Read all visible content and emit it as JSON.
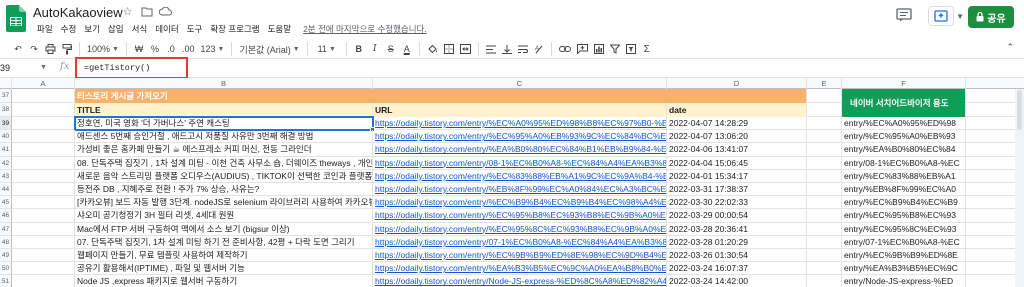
{
  "app": {
    "doc_title": "AutoKakaoview",
    "menu": [
      "파일",
      "수정",
      "보기",
      "삽입",
      "서식",
      "데이터",
      "도구",
      "확장 프로그램",
      "도움말"
    ],
    "last_edit": "2분 전에 마지막으로 수정했습니다.",
    "share_label": "공유"
  },
  "toolbar": {
    "zoom": "100%",
    "currency": "₩",
    "percent": "%",
    "dec_minus": ".0",
    "dec_plus": ".00",
    "number_format": "123",
    "font": "기본값 (Arial)",
    "font_size": "11",
    "bold": "B",
    "italic": "I",
    "strike": "S",
    "text_color": "A"
  },
  "formula": {
    "name_box": "39",
    "formula": "=getTistory()"
  },
  "columns": [
    "A",
    "B",
    "C",
    "D",
    "E",
    "F"
  ],
  "rows": [
    {
      "num": "37",
      "b": "티스토리 게시글 가져오기",
      "c": "",
      "d": "",
      "f": "네이버 서치어드바이저 용도",
      "type": "section"
    },
    {
      "num": "38",
      "b": "TITLE",
      "c": "URL",
      "d": "date",
      "f": "",
      "type": "header"
    },
    {
      "num": "39",
      "b": "정호연, 미국 영화 '더 가버나스' 주연 캐스팅",
      "c": "https://odaily.tistory.com/entry/%EC%A0%95%ED%98%B8%EC%97%B0-%E",
      "d": "2022-04-07 14:28:29",
      "f": "entry/%EC%A0%95%ED%98"
    },
    {
      "num": "40",
      "b": "애드센스 5번째 승인거절 , 애드고시 저품질 사유만 3번째 해결 방법",
      "c": "https://odaily.tistory.com/entry/%EC%95%A0%EB%93%9C%EC%84%BC%E",
      "d": "2022-04-07 13:06:20",
      "f": "entry/%EC%95%A0%EB%93"
    },
    {
      "num": "41",
      "b": "가성비 좋은 홈카페 만들기 ☕ 에스프레소 커피 머신, 전동 그라인더",
      "c": "https://odaily.tistory.com/entry/%EA%B0%80%EC%84%B1%EB%B9%84-%E",
      "d": "2022-04-06 13:41:07",
      "f": "entry/%EA%B0%80%EC%84"
    },
    {
      "num": "42",
      "b": "08. 단독주택 집짓기 , 1차 설계 미팅 - 이천 건축 사무소 숍, 더웨이즈 theways , 개인 건",
      "c": "https://odaily.tistory.com/entry/08-1%EC%B0%A8-%EC%84%A4%EA%B3%8",
      "d": "2022-04-04 15:06:45",
      "f": "entry/08-1%EC%B0%A8-%EC"
    },
    {
      "num": "43",
      "b": "새로운 음악 스트리밍 플랫폼 오디우스(AUDIUS) , TIKTOK이 선택한 코인과 플랫폼",
      "c": "https://odaily.tistory.com/entry/%EC%83%88%EB%A1%9C%EC%9A%B4-%E",
      "d": "2022-04-01 15:34:17",
      "f": "entry/%EC%83%88%EB%A1"
    },
    {
      "num": "44",
      "b": "등전주 DB , 지혜주로 전환 ! 주가 7% 상승, 사유는?",
      "c": "https://odaily.tistory.com/entry/%EB%8F%99%EC%A0%84%EC%A3%BC%E",
      "d": "2022-03-31 17:38:37",
      "f": "entry/%EB%8F%99%EC%A0"
    },
    {
      "num": "45",
      "b": "[카카오뷰] 보드 자동 발행 3단계. nodeJS로 selenium 라이브러리 사용하여 카카오뷰 -",
      "c": "https://odaily.tistory.com/entry/%EC%B9%B4%EC%B9%B4%EC%98%A4%E",
      "d": "2022-03-30 22:02:33",
      "f": "entry/%EC%B9%B4%EC%B9"
    },
    {
      "num": "46",
      "b": "샤오미 공기청정기 3H 필터 리셋, 4세대 원원",
      "c": "https://odaily.tistory.com/entry/%EC%95%B8%EC%93%B8%EC%9B%A0%E",
      "d": "2022-03-29 00:00:54",
      "f": "entry/%EC%95%B8%EC%93"
    },
    {
      "num": "47",
      "b": "Mac에서 FTP 서버 구동하여 맥에서 소스 보기 (bigsur 이상)",
      "c": "https://odaily.tistory.com/entry/%EC%95%8C%EC%93%B8%EC%9B%A0%E",
      "d": "2022-03-28 20:36:41",
      "f": "entry/%EC%95%8C%EC%93"
    },
    {
      "num": "48",
      "b": "07. 단독주택 집짓기, 1차 설계 미팅 하기 전 준비사항, 42평 + 다락 도면 그리기",
      "c": "https://odaily.tistory.com/entry/07-1%EC%B0%A8-%EC%84%A4%EA%B3%8",
      "d": "2022-03-28 01:20:29",
      "f": "entry/07-1%EC%B0%A8-%EC"
    },
    {
      "num": "49",
      "b": "웹페이지 만들기, 무료 템플릿 사용하여 제작하기",
      "c": "https://odaily.tistory.com/entry/%EC%9B%B9%ED%8E%98%EC%9D%B4%E",
      "d": "2022-03-26 01:30:54",
      "f": "entry/%EC%9B%B9%ED%8E"
    },
    {
      "num": "50",
      "b": "공유기 활용해서(IPTIME) , 파일 및 웹서버 기능",
      "c": "https://odaily.tistory.com/entry/%EA%B3%B5%EC%9C%A0%EA%B8%B0%E",
      "d": "2022-03-24 16:07:37",
      "f": "entry/%EA%B3%B5%EC%9C"
    },
    {
      "num": "51",
      "b": "Node JS ,express 패키지로 웹서버 구동하기",
      "c": "https://odaily.tistory.com/entry/Node-JS-express-%ED%8C%A8%ED%82%A4",
      "d": "2022-03-24 14:42:00",
      "f": "entry/Node-JS-express-%ED"
    }
  ],
  "colors": {
    "accent_green": "#0f9d58",
    "section_orange": "#f6b26b",
    "header_yellow": "#fff2cc",
    "link": "#1155cc",
    "highlight_red": "#e53935",
    "selection_blue": "#1a73e8"
  }
}
